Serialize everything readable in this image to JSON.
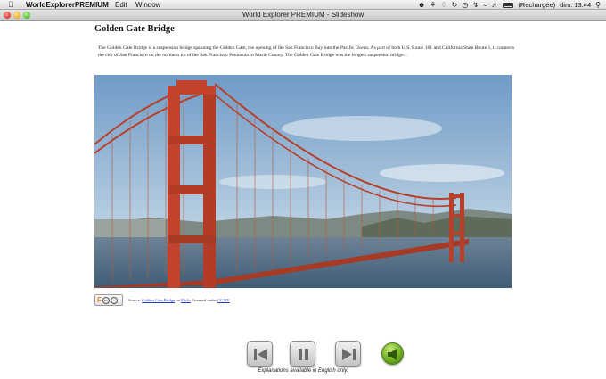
{
  "menubar": {
    "apple_icon": "apple-icon",
    "app_name": "WorldExplorerPREMIUM",
    "menus": [
      "Edit",
      "Window"
    ],
    "status": {
      "battery_text": "(Rechargée)",
      "clock": "dim. 13:44",
      "icons": [
        "user-icon",
        "evernote-icon",
        "dropbox-icon",
        "time-machine-icon",
        "clock-icon",
        "bluetooth-icon",
        "wifi-icon",
        "volume-icon",
        "battery-icon",
        "search-icon"
      ]
    }
  },
  "window": {
    "title": "World Explorer PREMIUM - Slideshow"
  },
  "slide": {
    "title": "Golden Gate Bridge",
    "description": "The Golden Gate Bridge is a suspension bridge spanning the Golden Gate, the opening of the San Francisco Bay into the Pacific Ocean. As part of both U.S. Route 101 and California State Route 1, it connects the city of San Francisco on the northern tip of the San Francisco Peninsula to Marin County. The Golden Gate Bridge was the longest suspension bridge...",
    "source": {
      "prefix": "Source:",
      "link_text": "Golden Gate Bridge",
      "on_text": "on",
      "site": "Flickr",
      "license_prefix": ", licensed under",
      "license": "CC BY",
      "badge_letter": "F"
    }
  },
  "controls": {
    "previous_icon": "skip-back-icon",
    "pause_icon": "pause-icon",
    "next_icon": "skip-forward-icon",
    "audio_icon": "speaker-icon",
    "note": "Explanations available in English only."
  },
  "colors": {
    "bridge": "#c1432b",
    "sky_top": "#6f9bc7",
    "sky_bottom": "#dbe6ee",
    "water": "#3f5d77",
    "audio_button": "#6fae22",
    "link": "#1a3bcc"
  }
}
